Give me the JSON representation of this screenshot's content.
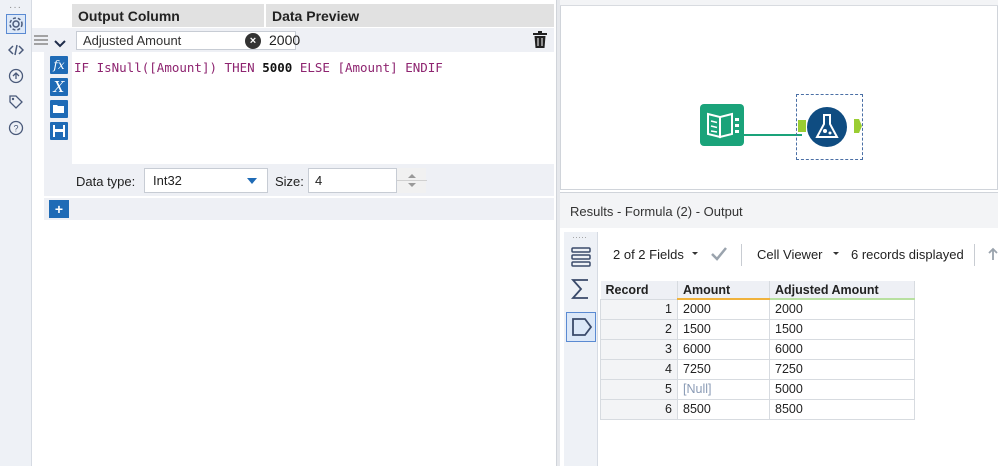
{
  "config": {
    "headers": {
      "output_column": "Output Column",
      "data_preview": "Data Preview"
    },
    "output_column_value": "Adjusted Amount",
    "preview_value": "2000",
    "expression": {
      "t1": "IF ",
      "t2": "IsNull",
      "t3": "(",
      "t4": "[Amount]",
      "t5": ") ",
      "t6": "THEN ",
      "t7": "5000",
      "t8": " ELSE ",
      "t9": "[Amount]",
      "t10": " ENDIF"
    },
    "data_type_label": "Data type:",
    "data_type_value": "Int32",
    "size_label": "Size:",
    "size_value": "4"
  },
  "results": {
    "title": "Results - Formula (2) - Output",
    "fields_label": "2 of 2 Fields",
    "viewer_label": "Cell Viewer",
    "records_label": "6 records displayed",
    "columns": [
      "Record",
      "Amount",
      "Adjusted Amount"
    ],
    "rows": [
      [
        "1",
        "2000",
        "2000"
      ],
      [
        "2",
        "1500",
        "1500"
      ],
      [
        "3",
        "6000",
        "6000"
      ],
      [
        "4",
        "7250",
        "7250"
      ],
      [
        "5",
        "[Null]",
        "5000"
      ],
      [
        "6",
        "8500",
        "8500"
      ]
    ]
  },
  "colors": {
    "accent_blue": "#1f6bb6",
    "tool_green": "#1aa37a",
    "tool_navy": "#0f4c81",
    "keyword": "#8e2470"
  }
}
